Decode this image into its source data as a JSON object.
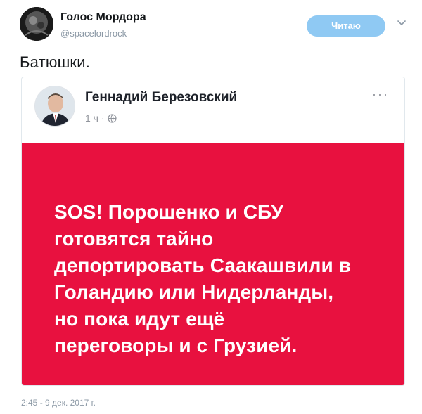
{
  "tweet": {
    "author_name": "Голос Мордора",
    "author_handle": "@spacelordrock",
    "follow_label": "Читаю",
    "text": "Батюшки.",
    "timestamp": "2:45 - 9 дек. 2017 г."
  },
  "embed": {
    "author_name": "Геннадий Березовский",
    "time_label": "1 ч ·",
    "more_label": "···",
    "panel_color": "#e8113f",
    "post_lines": [
      "SOS! Порошенко и СБУ",
      "готовятся тайно",
      "депортировать Саакашвили в",
      "Голандию или Нидерланды,",
      "но пока идут ещё",
      "переговоры и с Грузией."
    ]
  },
  "colors": {
    "follow_button": "#8fc9f3",
    "muted_text": "#8b98a5"
  },
  "icons": {
    "chevron": "chevron-down-icon",
    "globe": "globe-icon"
  }
}
